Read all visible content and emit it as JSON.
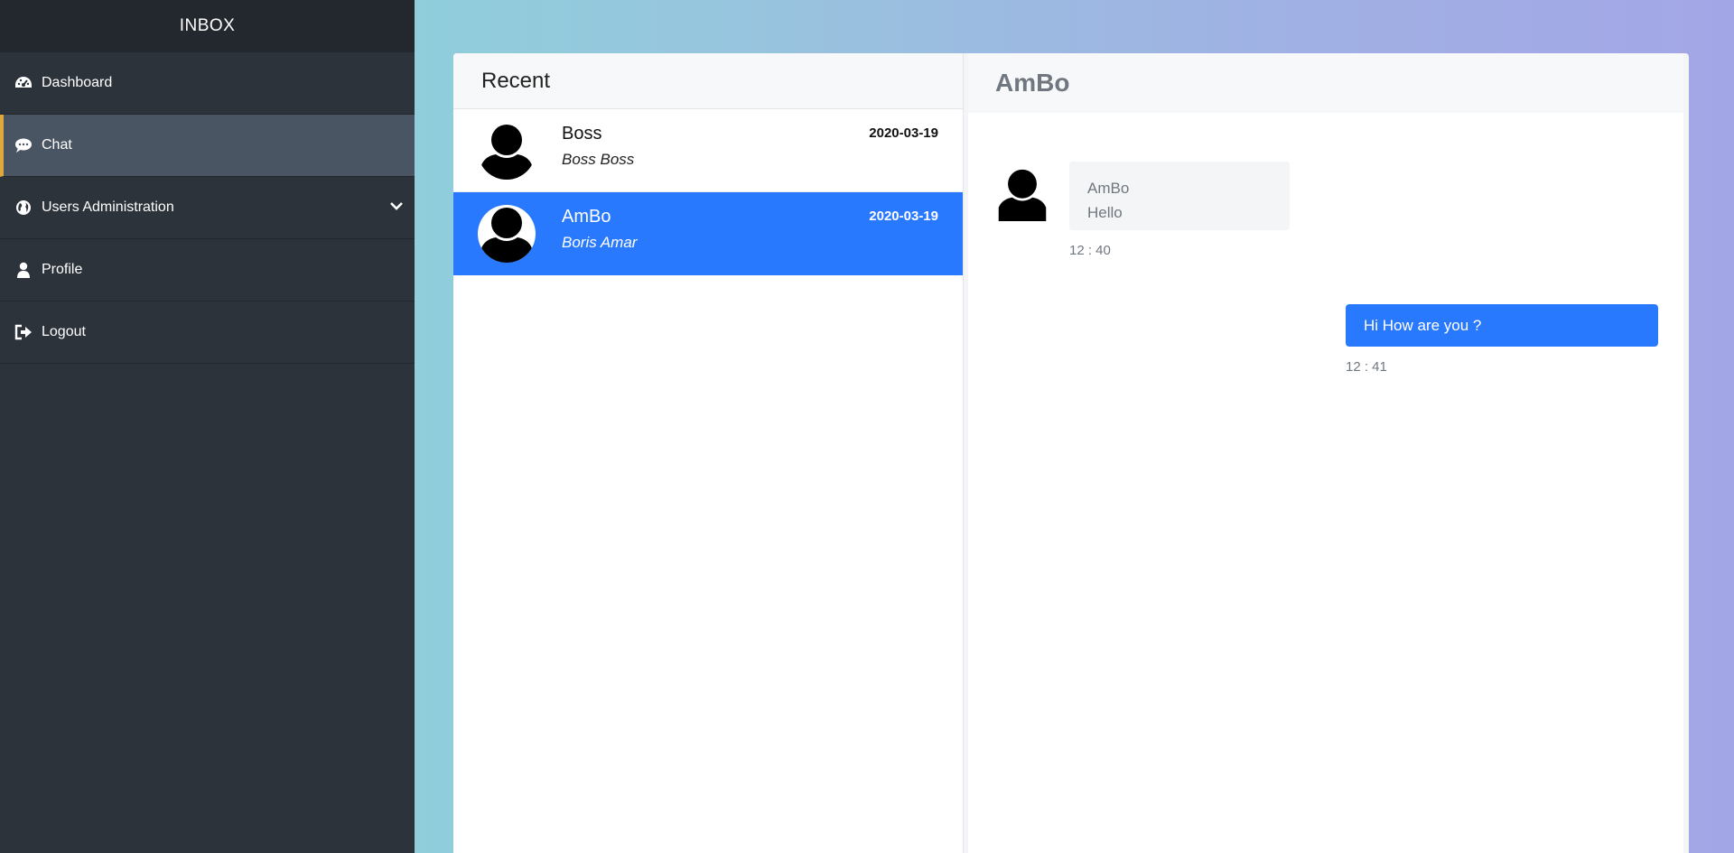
{
  "sidebar": {
    "title": "INBOX",
    "accent_color": "#e0a73a",
    "items": [
      {
        "label": "Dashboard",
        "icon": "dashboard-gauge-icon"
      },
      {
        "label": "Chat",
        "icon": "chat-bubble-icon",
        "active": true
      },
      {
        "label": "Users Administration",
        "icon": "globe-icon",
        "has_submenu": true
      },
      {
        "label": "Profile",
        "icon": "user-icon"
      },
      {
        "label": "Logout",
        "icon": "sign-out-icon"
      }
    ]
  },
  "recent": {
    "title": "Recent",
    "conversations": [
      {
        "name": "Boss",
        "full_name": "Boss Boss",
        "date": "2020-03-19",
        "selected": false
      },
      {
        "name": "AmBo",
        "full_name": "Boris Amar",
        "date": "2020-03-19",
        "selected": true
      }
    ]
  },
  "chat": {
    "title": "AmBo",
    "messages": [
      {
        "direction": "incoming",
        "sender": "AmBo",
        "text": "Hello",
        "time": "12 : 40"
      },
      {
        "direction": "outgoing",
        "text": "Hi How are you ?",
        "time": "12 : 41"
      }
    ]
  },
  "colors": {
    "sidebar_bg": "#2d333b",
    "selected_blue": "#2979fe"
  }
}
